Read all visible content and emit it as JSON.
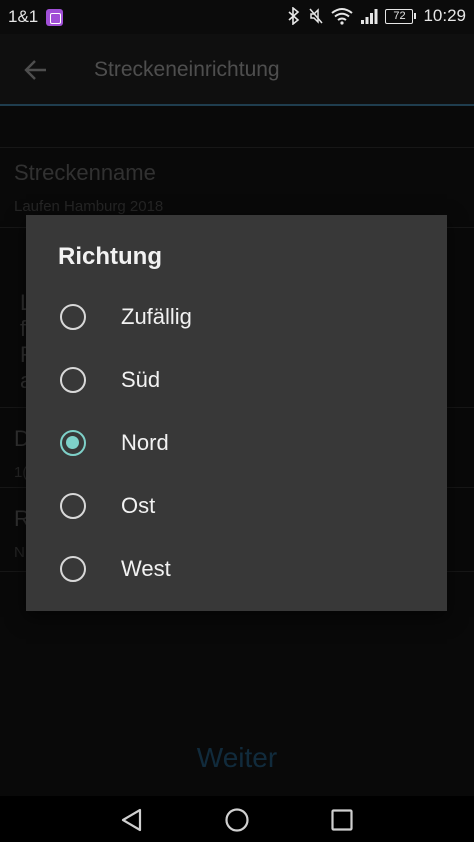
{
  "status_bar": {
    "carrier": "1&1",
    "battery_level": "72",
    "time": "10:29",
    "icons": [
      "app-notification-icon",
      "bluetooth-icon",
      "mute-icon",
      "wifi-icon",
      "signal-icon",
      "battery-icon"
    ]
  },
  "app_bar": {
    "title": "Streckeneinrichtung",
    "back_icon": "arrow-left-icon"
  },
  "background": {
    "route_name_label": "Streckenname",
    "route_name_value": "Laufen Hamburg 2018",
    "partial_text_lines": [
      "L",
      "f",
      "R",
      "a"
    ],
    "row2_label_partial": "D",
    "row2_value_partial": "1(",
    "row3_label_partial": "R",
    "row3_value_partial": "N"
  },
  "dialog": {
    "title": "Richtung",
    "selected": "Nord",
    "options": [
      {
        "label": "Zufällig",
        "checked": false
      },
      {
        "label": "Süd",
        "checked": false
      },
      {
        "label": "Nord",
        "checked": true
      },
      {
        "label": "Ost",
        "checked": false
      },
      {
        "label": "West",
        "checked": false
      }
    ]
  },
  "next_button": {
    "label": "Weiter"
  },
  "colors": {
    "accent": "#7ed0c8",
    "dialog_bg": "#383838",
    "next_button": "#1f4f6e",
    "app_bar_divider": "#3a6f8f"
  },
  "nav_bar": {
    "icons": [
      "back-triangle-icon",
      "home-circle-icon",
      "recents-square-icon"
    ]
  }
}
